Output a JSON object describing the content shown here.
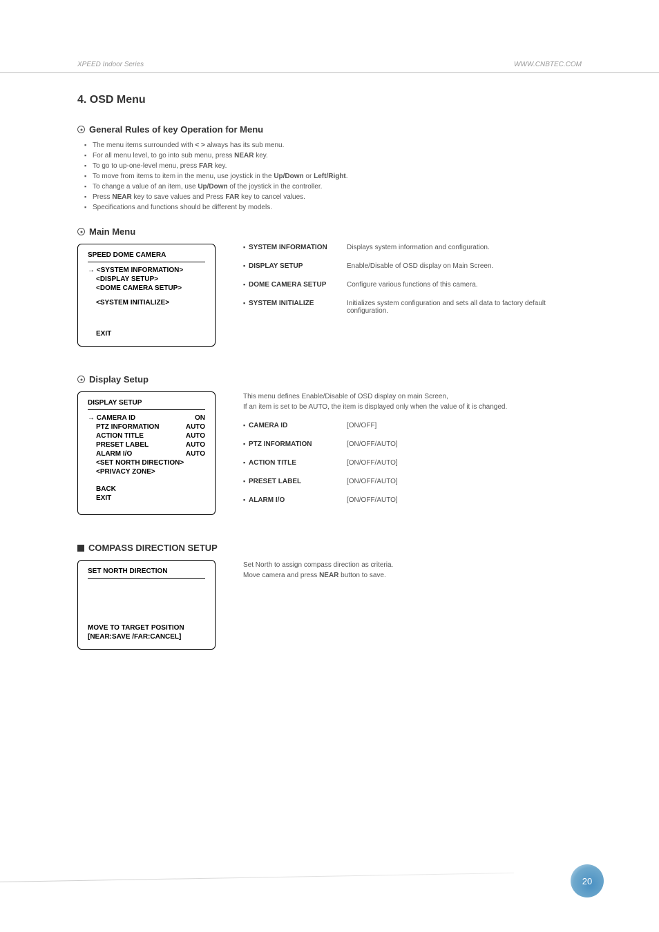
{
  "header": {
    "left": "XPEED Indoor Series",
    "right": "WWW.CNBTEC.COM"
  },
  "title": "4. OSD Menu",
  "general_rules": {
    "heading": "General Rules of key Operation for Menu",
    "items": [
      {
        "pre": "The menu items surrounded with ",
        "b1": "< >",
        "post": " always has its sub menu."
      },
      {
        "pre": "For all menu level, to go into sub menu, press ",
        "b1": "NEAR",
        "post": " key."
      },
      {
        "pre": "To go to up-one-level menu, press ",
        "b1": "FAR",
        "post": " key."
      },
      {
        "pre": "To move from items to item in the menu, use joystick in the ",
        "b1": "Up/Down",
        "mid": " or ",
        "b2": "Left/Right",
        "post": "."
      },
      {
        "pre": "To change a value of an item, use ",
        "b1": "Up/Down",
        "post": " of the joystick in the controller."
      },
      {
        "pre": "Press ",
        "b1": "NEAR",
        "mid": " key to save values and Press ",
        "b2": "FAR",
        "post": " key to cancel values."
      },
      {
        "pre": "Specifications and functions should be different by models.",
        "b1": "",
        "post": ""
      }
    ]
  },
  "main_menu": {
    "heading": "Main Menu",
    "box": {
      "title": "SPEED DOME CAMERA",
      "lines": [
        "→ <SYSTEM INFORMATION>",
        "<DISPLAY SETUP>",
        "<DOME CAMERA SETUP>",
        "",
        "<SYSTEM INITIALIZE>",
        "",
        "",
        "",
        "",
        "EXIT"
      ]
    },
    "rows": [
      {
        "label": "SYSTEM INFORMATION",
        "desc": "Displays system information and configuration."
      },
      {
        "label": "DISPLAY SETUP",
        "desc": "Enable/Disable of OSD display on Main Screen."
      },
      {
        "label": "DOME CAMERA SETUP",
        "desc": "Configure various functions of this camera."
      },
      {
        "label": "SYSTEM INITIALIZE",
        "desc": "Initializes system configuration and sets all data to factory default configuration."
      }
    ]
  },
  "display_setup": {
    "heading": "Display Setup",
    "box": {
      "title": "DISPLAY SETUP",
      "rows": [
        {
          "l": "→ CAMERA ID",
          "r": "ON"
        },
        {
          "l": "PTZ INFORMATION",
          "r": "AUTO"
        },
        {
          "l": "ACTION TITLE",
          "r": "AUTO"
        },
        {
          "l": "PRESET LABEL",
          "r": "AUTO"
        },
        {
          "l": "ALARM I/O",
          "r": "AUTO"
        },
        {
          "l": "<SET NORTH DIRECTION>",
          "r": ""
        },
        {
          "l": "<PRIVACY ZONE>",
          "r": ""
        }
      ],
      "footer": [
        "BACK",
        "EXIT"
      ]
    },
    "intro1": "This menu defines Enable/Disable of OSD display on main Screen,",
    "intro2": "If an item is set to be AUTO, the item is displayed only when the value of it is changed.",
    "rows": [
      {
        "label": "CAMERA ID",
        "desc": "[ON/OFF]"
      },
      {
        "label": "PTZ INFORMATION",
        "desc": "[ON/OFF/AUTO]"
      },
      {
        "label": "ACTION TITLE",
        "desc": "[ON/OFF/AUTO]"
      },
      {
        "label": "PRESET LABEL",
        "desc": "[ON/OFF/AUTO]"
      },
      {
        "label": "ALARM I/O",
        "desc": "[ON/OFF/AUTO]"
      }
    ]
  },
  "compass": {
    "heading": "COMPASS DIRECTION SETUP",
    "box": {
      "title": "SET NORTH DIRECTION",
      "footer1": "MOVE TO TARGET POSITION",
      "footer2": "[NEAR:SAVE   /FAR:CANCEL]"
    },
    "note_pre": "Set North to assign compass direction as criteria.",
    "note_line2a": "Move camera and press ",
    "note_bold": "NEAR",
    "note_line2b": " button to save."
  },
  "page_number": "20"
}
